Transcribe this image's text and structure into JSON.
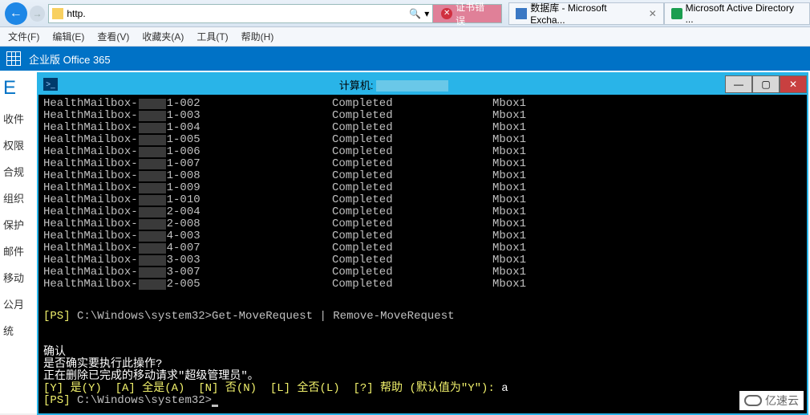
{
  "ie": {
    "address_prefix": "http.",
    "cert_error": "证书错误",
    "tabs": [
      {
        "label": "数据库 - Microsoft Excha..."
      },
      {
        "label": "Microsoft Active Directory ..."
      }
    ],
    "menu": {
      "file": "文件(F)",
      "edit": "编辑(E)",
      "view": "查看(V)",
      "favorites": "收藏夹(A)",
      "tools": "工具(T)",
      "help": "帮助(H)"
    }
  },
  "exchange": {
    "suite_label": "企业版   Office 365",
    "brand_letter": "E",
    "nav": [
      "收件",
      "权限",
      "合规",
      "组织",
      "保护",
      "邮件",
      "移动",
      "公月",
      "统"
    ]
  },
  "ps": {
    "title_prefix": "计算机:",
    "rows": [
      {
        "prefix": "HealthMailbox-",
        "suffix": "1-002",
        "status": "Completed",
        "target": "Mbox1"
      },
      {
        "prefix": "HealthMailbox-",
        "suffix": "1-003",
        "status": "Completed",
        "target": "Mbox1"
      },
      {
        "prefix": "HealthMailbox-",
        "suffix": "1-004",
        "status": "Completed",
        "target": "Mbox1"
      },
      {
        "prefix": "HealthMailbox-",
        "suffix": "1-005",
        "status": "Completed",
        "target": "Mbox1"
      },
      {
        "prefix": "HealthMailbox-",
        "suffix": "1-006",
        "status": "Completed",
        "target": "Mbox1"
      },
      {
        "prefix": "HealthMailbox-",
        "suffix": "1-007",
        "status": "Completed",
        "target": "Mbox1"
      },
      {
        "prefix": "HealthMailbox-",
        "suffix": "1-008",
        "status": "Completed",
        "target": "Mbox1"
      },
      {
        "prefix": "HealthMailbox-",
        "suffix": "1-009",
        "status": "Completed",
        "target": "Mbox1"
      },
      {
        "prefix": "HealthMailbox-",
        "suffix": "1-010",
        "status": "Completed",
        "target": "Mbox1"
      },
      {
        "prefix": "HealthMailbox-",
        "suffix": "2-004",
        "status": "Completed",
        "target": "Mbox1"
      },
      {
        "prefix": "HealthMailbox-",
        "suffix": "2-008",
        "status": "Completed",
        "target": "Mbox1"
      },
      {
        "prefix": "HealthMailbox-",
        "suffix": "4-003",
        "status": "Completed",
        "target": "Mbox1"
      },
      {
        "prefix": "HealthMailbox-",
        "suffix": "4-007",
        "status": "Completed",
        "target": "Mbox1"
      },
      {
        "prefix": "HealthMailbox-",
        "suffix": "3-003",
        "status": "Completed",
        "target": "Mbox1"
      },
      {
        "prefix": "HealthMailbox-",
        "suffix": "3-007",
        "status": "Completed",
        "target": "Mbox1"
      },
      {
        "prefix": "HealthMailbox-",
        "suffix": "2-005",
        "status": "Completed",
        "target": "Mbox1"
      }
    ],
    "prompt_prefix": "[PS] ",
    "prompt_path": "C:\\Windows\\system32>",
    "command": "Get-MoveRequest | Remove-MoveRequest",
    "confirm_title": "确认",
    "confirm_q": "是否确实要执行此操作?",
    "confirm_detail": "正在删除已完成的移动请求\"超级管理员\"。",
    "choices": "[Y] 是(Y)  [A] 全是(A)  [N] 否(N)  [L] 全否(L)  [?] 帮助 (默认值为\"Y\"): ",
    "answer": "a"
  },
  "watermark": "亿速云"
}
